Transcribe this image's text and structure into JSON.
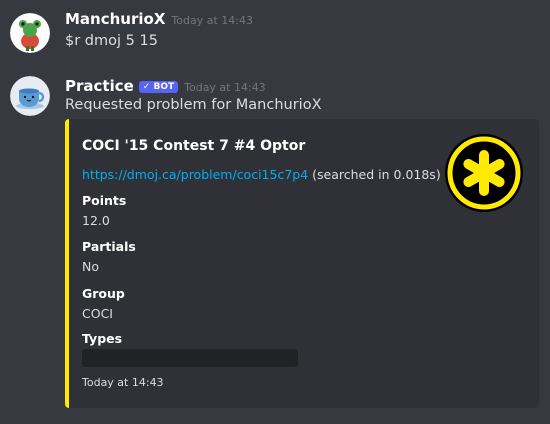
{
  "messages": [
    {
      "author": "ManchurioX",
      "timestamp": "Today at 14:43",
      "content": "$r dmoj 5 15",
      "avatar_icon": "frog-avatar-icon"
    },
    {
      "author": "Practice",
      "bot_tag": "✓ BOT",
      "timestamp": "Today at 14:43",
      "content": "Requested problem for ManchurioX",
      "avatar_icon": "teacup-avatar-icon"
    }
  ],
  "embed": {
    "accent_color": "#ffea00",
    "title": "COCI '15 Contest 7 #4 Optor",
    "link": "https://dmoj.ca/problem/coci15c7p4",
    "search_note": "(searched in 0.018s)",
    "fields": [
      {
        "name": "Points",
        "value": "12.0"
      },
      {
        "name": "Partials",
        "value": "No"
      },
      {
        "name": "Group",
        "value": "COCI"
      },
      {
        "name": "Types",
        "value": ""
      }
    ],
    "footer": "Today at 14:43",
    "thumbnail_icon": "dmoj-asterisk-logo-icon"
  }
}
